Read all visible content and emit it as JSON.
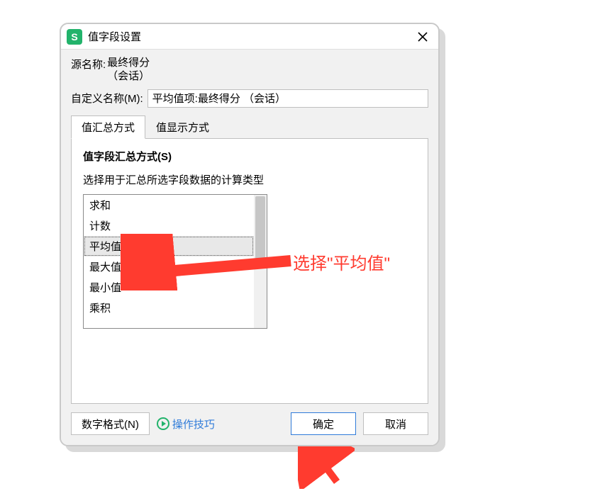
{
  "window": {
    "title": "值字段设置"
  },
  "source": {
    "label": "源名称:",
    "line1": "最终得分",
    "line2": "（会话）"
  },
  "customName": {
    "label": "自定义名称(M):",
    "value": "平均值项:最终得分 （会话）"
  },
  "tabs": {
    "summary": "值汇总方式",
    "display": "值显示方式"
  },
  "panel": {
    "title": "值字段汇总方式(S)",
    "desc": "选择用于汇总所选字段数据的计算类型",
    "items": [
      "求和",
      "计数",
      "平均值",
      "最大值",
      "最小值",
      "乘积"
    ],
    "selectedIndex": 2
  },
  "footer": {
    "numberFormat": "数字格式(N)",
    "tips": "操作技巧",
    "ok": "确定",
    "cancel": "取消"
  },
  "annotations": {
    "selectAvg": "选择\"平均值\""
  }
}
